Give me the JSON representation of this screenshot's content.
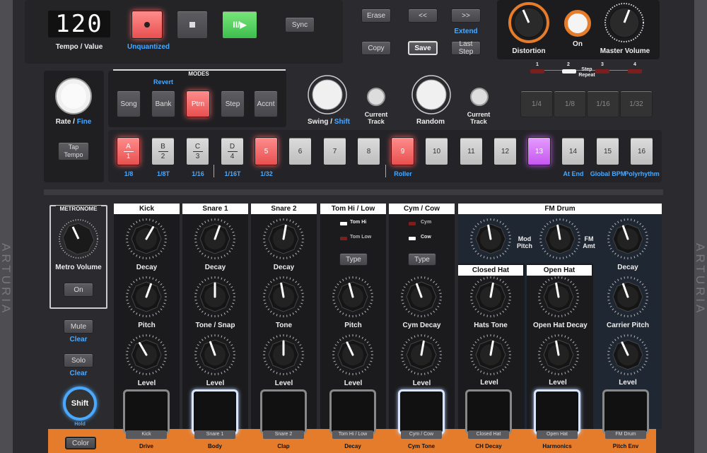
{
  "display": {
    "value": "120",
    "label": "Tempo / Value"
  },
  "transport": {
    "record_label": "Unquantized",
    "sync": "Sync"
  },
  "edit": {
    "erase": "Erase",
    "rewind": "<<",
    "forward": ">>",
    "extend": "Extend",
    "copy": "Copy",
    "save": "Save",
    "last_step": "Last Step"
  },
  "fx": {
    "distortion": "Distortion",
    "on": "On",
    "master_volume": "Master Volume"
  },
  "step_repeat": {
    "label": "Step\nRepeat",
    "numbers": [
      "1",
      "2",
      "3",
      "4"
    ],
    "active": 2
  },
  "left": {
    "rate": "Rate",
    "fine": "Fine",
    "tap_tempo": "Tap\nTempo"
  },
  "modes": {
    "title": "MODES",
    "revert": "Revert",
    "buttons": [
      "Song",
      "Bank",
      "Ptrn",
      "Step",
      "Accnt"
    ]
  },
  "swing": {
    "swing": "Swing",
    "shift": "Shift",
    "current_track_a": "Current\nTrack",
    "random": "Random",
    "current_track_b": "Current\nTrack"
  },
  "division_buttons": [
    "1/4",
    "1/8",
    "1/16",
    "1/32"
  ],
  "steps": [
    {
      "top": "A",
      "bottom": "1",
      "state": "red",
      "sub": "1/8"
    },
    {
      "top": "B",
      "bottom": "2",
      "state": "off",
      "sub": "1/8T"
    },
    {
      "top": "C",
      "bottom": "3",
      "state": "off",
      "sub": "1/16"
    },
    {
      "top": "D",
      "bottom": "4",
      "state": "off",
      "sub": "1/16T"
    },
    {
      "top": "",
      "bottom": "5",
      "state": "red",
      "sub": "1/32"
    },
    {
      "top": "",
      "bottom": "6",
      "state": "off",
      "sub": ""
    },
    {
      "top": "",
      "bottom": "7",
      "state": "off",
      "sub": ""
    },
    {
      "top": "",
      "bottom": "8",
      "state": "off",
      "sub": ""
    },
    {
      "top": "",
      "bottom": "9",
      "state": "red",
      "sub": "Roller"
    },
    {
      "top": "",
      "bottom": "10",
      "state": "off",
      "sub": ""
    },
    {
      "top": "",
      "bottom": "11",
      "state": "off",
      "sub": ""
    },
    {
      "top": "",
      "bottom": "12",
      "state": "off",
      "sub": ""
    },
    {
      "top": "",
      "bottom": "13",
      "state": "purple",
      "sub": ""
    },
    {
      "top": "",
      "bottom": "14",
      "state": "off",
      "sub": "At End"
    },
    {
      "top": "",
      "bottom": "15",
      "state": "off",
      "sub": "Global BPM"
    },
    {
      "top": "",
      "bottom": "16",
      "state": "off",
      "sub": "Polyrhythm"
    }
  ],
  "metronome": {
    "title": "METRONOME",
    "knob": "Metro Volume",
    "on": "On"
  },
  "mute": {
    "label": "Mute",
    "clear": "Clear"
  },
  "solo": {
    "label": "Solo",
    "clear": "Clear"
  },
  "shift": {
    "label": "Shift",
    "hold": "Hold"
  },
  "color_btn": "Color",
  "tracks": [
    {
      "name": "Kick",
      "k1": "Decay",
      "k2": "Pitch",
      "k3": "Level",
      "pad": "Kick",
      "strip": "Drive"
    },
    {
      "name": "Snare 1",
      "k1": "Decay",
      "k2": "Tone / Snap",
      "k3": "Level",
      "pad": "Snare 1",
      "strip": "Body"
    },
    {
      "name": "Snare 2",
      "k1": "Decay",
      "k2": "Tone",
      "k3": "Level",
      "pad": "Snare 2",
      "strip": "Clap"
    },
    {
      "name": "Tom Hi / Low",
      "k1": "",
      "k2": "Pitch",
      "k3": "Level",
      "pad": "Tom Hi / Low",
      "strip": "Decay"
    },
    {
      "name": "Cym / Cow",
      "k1": "",
      "k2": "Cym Decay",
      "k3": "Level",
      "pad": "Cym / Cow",
      "strip": "Cym Tone"
    }
  ],
  "tom": {
    "hi": "Tom Hi",
    "low": "Tom Low",
    "type": "Type"
  },
  "cym": {
    "cym": "Cym",
    "cow": "Cow",
    "type": "Type"
  },
  "fm": {
    "title": "FM Drum",
    "mod_pitch": "Mod\nPitch",
    "fm_amt": "FM\nAmt",
    "decay": "Decay",
    "carrier_pitch": "Carrier Pitch",
    "level": "Level",
    "pad": "FM Drum",
    "strip": "Pitch Env"
  },
  "closed_hat": {
    "title": "Closed Hat",
    "knob": "Hats Tone",
    "level": "Level",
    "pad": "Closed Hat",
    "strip": "CH Decay"
  },
  "open_hat": {
    "title": "Open Hat",
    "knob": "Open Hat Decay",
    "level": "Level",
    "pad": "Open Hat",
    "strip": "Harmonics"
  },
  "brand": "ARTURIA",
  "colors": {
    "accent": "#e57c2b",
    "blue": "#4aa8ff",
    "red": "#ff6464",
    "purple": "#c557f0",
    "green": "#3dbd4f"
  }
}
